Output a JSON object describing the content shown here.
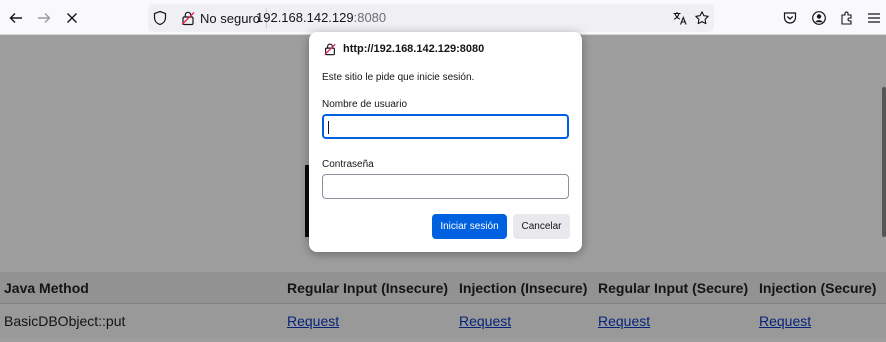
{
  "browser": {
    "security_label": "No seguro",
    "url_host": "192.168.142.129",
    "url_port": ":8080"
  },
  "dialog": {
    "origin": "http://192.168.142.129:8080",
    "message": "Este sitio le pide que inicie sesión.",
    "username_label": "Nombre de usuario",
    "username_value": "",
    "password_label": "Contraseña",
    "password_value": "",
    "login_button": "Iniciar sesión",
    "cancel_button": "Cancelar"
  },
  "table": {
    "headers": [
      "Java Method",
      "Regular Input (Insecure)",
      "Injection (Insecure)",
      "Regular Input (Secure)",
      "Injection (Secure)"
    ],
    "rows": [
      [
        "BasicDBObject::put",
        "Request",
        "Request",
        "Request",
        "Request"
      ]
    ]
  },
  "colors": {
    "accent": "#0061e0",
    "link": "#0b38c6"
  }
}
